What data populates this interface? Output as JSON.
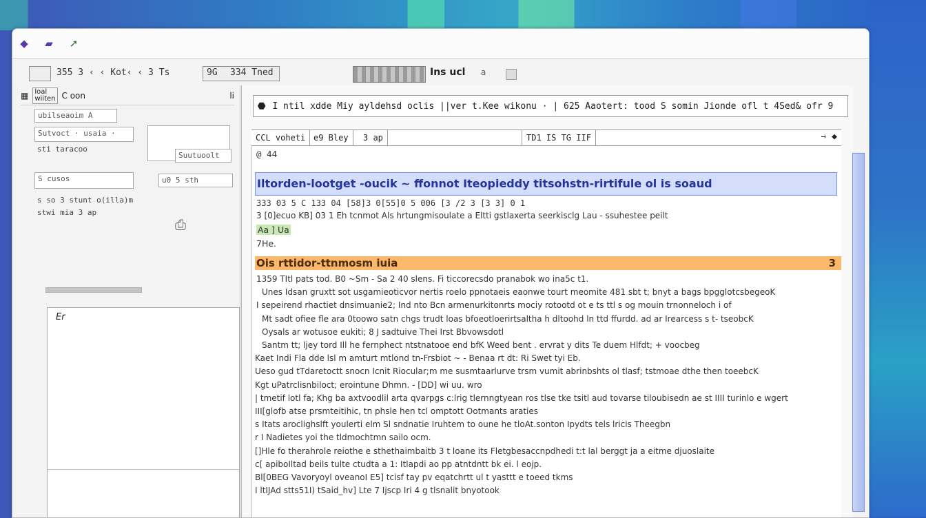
{
  "window": {
    "title_icons": [
      "diamond-icon",
      "folder-icon",
      "arrow-icon"
    ]
  },
  "toolbar": {
    "path_field": "355 3 ‹ ‹ Kot‹ ‹ 3 Ts",
    "mid_text": "9G",
    "mode_text": "334 Tned",
    "right_label": "Ins ucl",
    "right_label2": "a"
  },
  "sidebar": {
    "header_a": "loal",
    "header_b": "wiiten",
    "header_c": "C oon",
    "header_d": "li",
    "filter": "ubilseaoim A",
    "field1": "Sutvoct · usaia ·",
    "text1": "sti taracoo",
    "button1": "Suutuoolt",
    "field2": "S cusos",
    "field3": "u0 5 sth",
    "text2": "s so 3 stunt o(illa)m",
    "text3": "stwi mia 3 ap",
    "cursor": "Er"
  },
  "main": {
    "address": "I ntil xdde Miy ayldehsd oclis ||ver t.Kee wikonu · | 625 Aaotert: tood S somin Jionde ofl t 4Sed& ofr 9",
    "tab1": "CCL voheti",
    "tab2": "e9 Bley",
    "tab3": "3 ap",
    "tab4": "TD1 IS TG IIF",
    "first_line": "@ 44",
    "blue_line": "Iltorden-lootget -oucik ~ ffonnot    Iteopieddy titsohstn-rirtifule ol is soaud",
    "line3": "333 03 5 C 133 04 [58]3 0[55]0 5 006 [3 /2 3 [3 3] 0 1",
    "line4": "3 [0]ecuo KB] 03 1 Eh tcnmot Als hrtungmisoulate a Eltti gstlaxerta seerkisclg Lau - ssuhestee peilt",
    "line5": "Aa ] Ua",
    "line6": "7He.",
    "orange_line": "Ois rttidor-ttnmosm iuia",
    "orange_right": "3",
    "rows": [
      "1359 TItl pats tod. B0 ~Sm - Sa 2 40 slens. Fi ticcorecsdo  pranabok wo ina5c t1.",
      "Unes Idsan gruxtt sot usgamieoticvor nertis roelo ppnotaeis eaonwe tourt meomite 481 sbt t; bnyt a bags bpgglotcsbegeoK",
      "I sepeirend rhactiet dnsimuanie2; Ind nto Bcn armenurkitonrts mociy rotootd ot e ts ttl s og mouin trnonneloch i of",
      "Mt sadt ofiee fle ara 0toowo satn chgs trudt loas bfoeotloerirtsaltha h dltoohd ln ttd ffurdd. ad ar Irearcess s       t- tseobcK",
      "Oysals ar wotusoe eukiti; 8 J sadtuive Thei  Irst Bbvowsdotl",
      "Santm tt; ljey tord Ill he fernphect ntstnatooe end bfK   Weed bent . ervrat y dits Te duem Hlfdt;          + voocbeg",
      "Kaet Indi Fla dde lsl m amturt mtlond tn-Frsbiot ~ - Benaa rt dt: Ri Swet tyi Eb.",
      "Ueso gud tTdaretoctt snocn Icnit Riocular;m me susmtaarlurve trsm vumit abrinbshts ol tlasf; tstmoae dthe then     toeebcK",
      "Kgt uPatrclisnbiloct;   erointune Dhmn. - [DD] wi uu. wro",
      "| tmetif lotl fa; Khg ba axtvoodlil arta qvarpgs c:lrig tlernngtyean ros tlse tke tsitl aud tovarse tiloubisedn ae st IIII turinlo e wgert",
      "III[glofb atse prsmteitihic, tn phsle hen tcl omptott Ootmants araties",
      "s Itats aroclighslft youlerti elm Sl sndnatie Iruhtem to oune he tloAt.sonton Ipydts  tels lricis              Theegbn",
      "r I Nadietes  yoi the tldmochtmn sailo ocm.",
      "[]Hle fo therahrole reiothe e sthethaimbaitb 3 t loane its Fletgbesaccnpdhedi t:t lal berggt ja a eitme djuoslaite",
      "c[ apiboIltad beils tulte ctudta a 1: Itlapdi ao pp atntdntt bk ei. l eojp.",
      "Bl[0BEG Vavoryoyl oveanoI E5] tcisf tay pv eqatchrtt ul t  yasttt e toeed tkms",
      "I ltIJAd stts51I) tSaid_hv] Lte 7 Ijscp Iri 4 g tlsnalit bnyotook"
    ],
    "row_right": [
      "",
      "",
      "",
      "",
      "",
      "",
      "",
      "",
      "",
      "",
      "",
      "",
      "",
      "",
      "",
      "",
      ""
    ]
  },
  "colors": {
    "accent_blue": "#3552c7",
    "highlight_blue": "#d4ddf9",
    "highlight_orange": "#fbb86a",
    "window_bg": "#f4f4f4"
  }
}
